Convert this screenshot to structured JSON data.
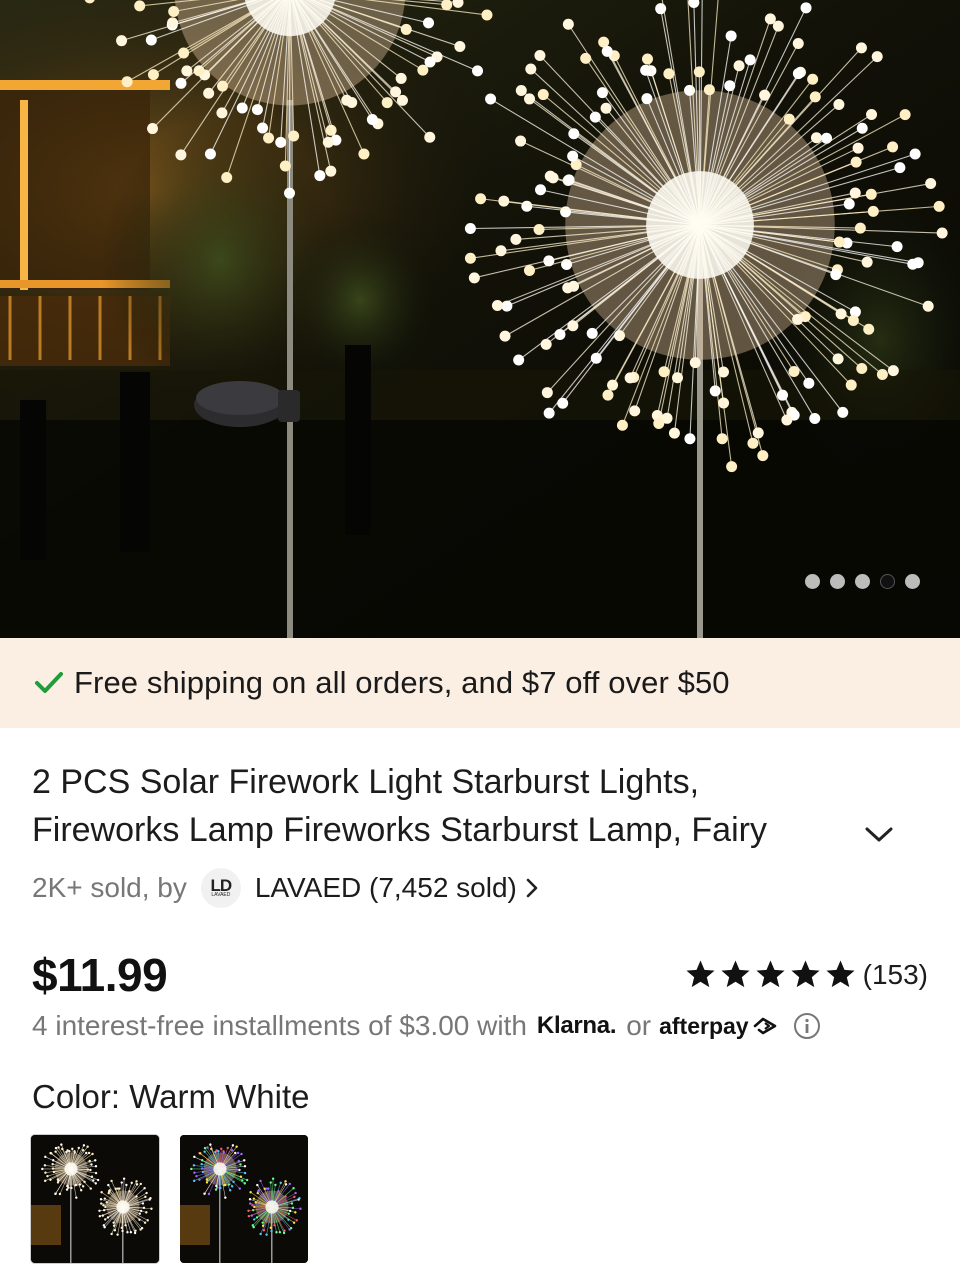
{
  "product": {
    "hero_image": "solar-firework-starburst-lights-photo",
    "carousel": {
      "count": 5,
      "active_index": 3
    },
    "shipping_banner": "Free shipping on all orders, and $7 off over $50",
    "title_line1": "2 PCS Solar Firework Light Starburst Lights,",
    "title_line2": "Fireworks Lamp Fireworks Starburst Lamp, Fairy",
    "sold_prefix": "2K+ sold, by",
    "seller_logo_text": "LD",
    "seller_logo_sub": "LAVAED",
    "seller": "LAVAED (7,452 sold)",
    "price": "$11.99",
    "rating": {
      "stars": 5,
      "count": "(153)"
    },
    "installments_text": "4 interest-free installments of $3.00 with",
    "klarna_label": "Klarna.",
    "or_label": "or",
    "afterpay_label": "afterpay",
    "color_label": "Color: Warm White",
    "swatches": [
      {
        "name": "Warm White",
        "selected": true
      },
      {
        "name": "Multicolor",
        "selected": false
      }
    ]
  },
  "colors": {
    "banner_bg": "#fbeee2",
    "check_green": "#1f9d3a",
    "text_primary": "#1c1c1c",
    "text_secondary": "#777777",
    "warm_light": "#fff3d6"
  },
  "icons": [
    "check-icon",
    "chevron-down-icon",
    "chevron-right-icon",
    "star-icon",
    "info-icon",
    "afterpay-logo-icon"
  ]
}
